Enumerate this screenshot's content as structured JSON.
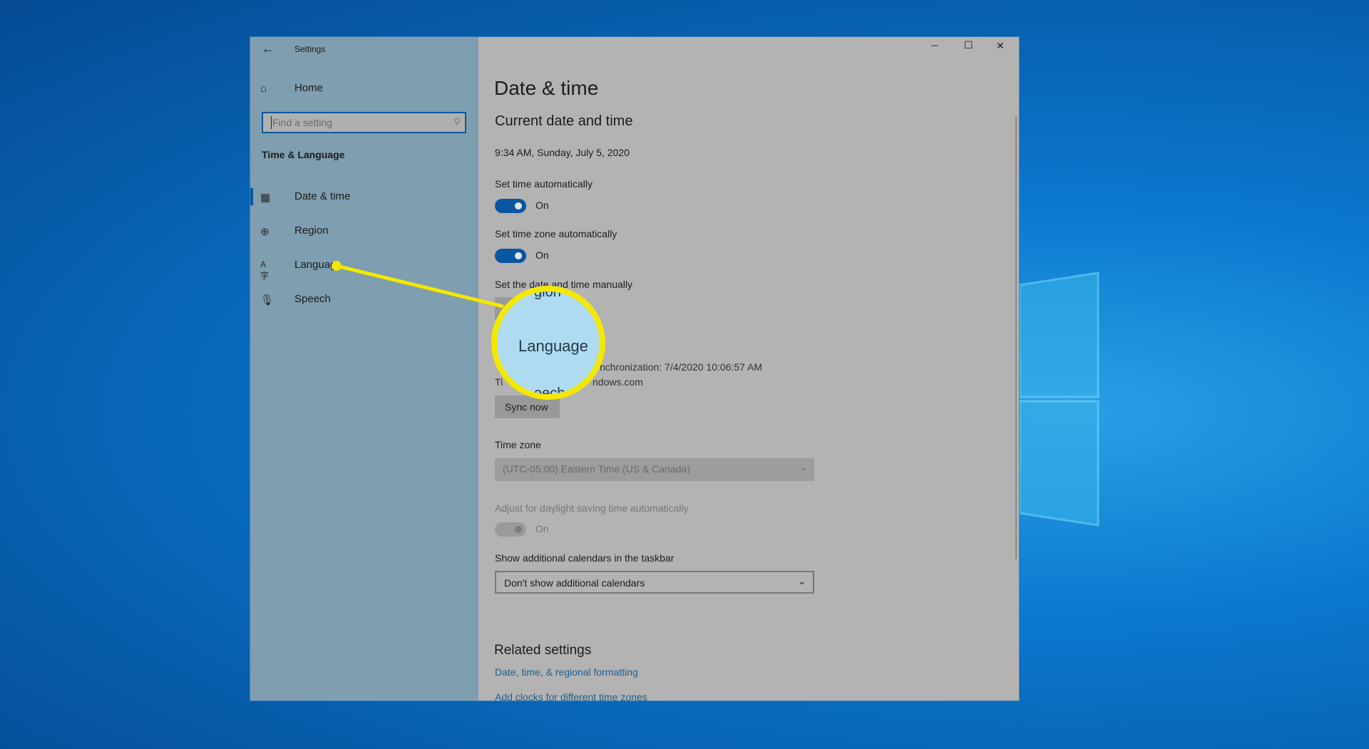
{
  "window": {
    "title": "Settings",
    "controls": {
      "minimize": "─",
      "maximize": "☐",
      "close": "✕"
    }
  },
  "sidebar": {
    "home": "Home",
    "search_placeholder": "Find a setting",
    "section": "Time & Language",
    "items": [
      {
        "label": "Date & time",
        "icon": "calendar-clock-icon",
        "selected": true
      },
      {
        "label": "Region",
        "icon": "globe-icon"
      },
      {
        "label": "Language",
        "icon": "language-icon"
      },
      {
        "label": "Speech",
        "icon": "microphone-icon"
      }
    ]
  },
  "main": {
    "title": "Date & time",
    "subtitle": "Current date and time",
    "current": "9:34 AM, Sunday, July 5, 2020",
    "set_time_auto": {
      "label": "Set time automatically",
      "state": "On"
    },
    "set_tz_auto": {
      "label": "Set time zone automatically",
      "state": "On"
    },
    "manual_label": "Set the date and time manually",
    "sync_last": "nchronization: 7/4/2020 10:06:57 AM",
    "sync_server": "ndows.com",
    "sync_server_prefix": "Ti",
    "sync_button": "Sync now",
    "time_zone": {
      "label": "Time zone",
      "value": "(UTC-05:00) Eastern Time (US & Canada)"
    },
    "daylight": {
      "label": "Adjust for daylight saving time automatically",
      "state": "On"
    },
    "calendars": {
      "label": "Show additional calendars in the taskbar",
      "value": "Don't show additional calendars"
    },
    "related": {
      "title": "Related settings",
      "link1": "Date, time, & regional formatting",
      "link2": "Add clocks for different time zones"
    }
  },
  "callout": {
    "label": "Language",
    "top_fragment": "gion",
    "bottom_fragment": "eech",
    "color": "#f5e800"
  },
  "colors": {
    "accent": "#0a56a0",
    "highlight": "#f5e800",
    "link": "#1f5f8f"
  }
}
